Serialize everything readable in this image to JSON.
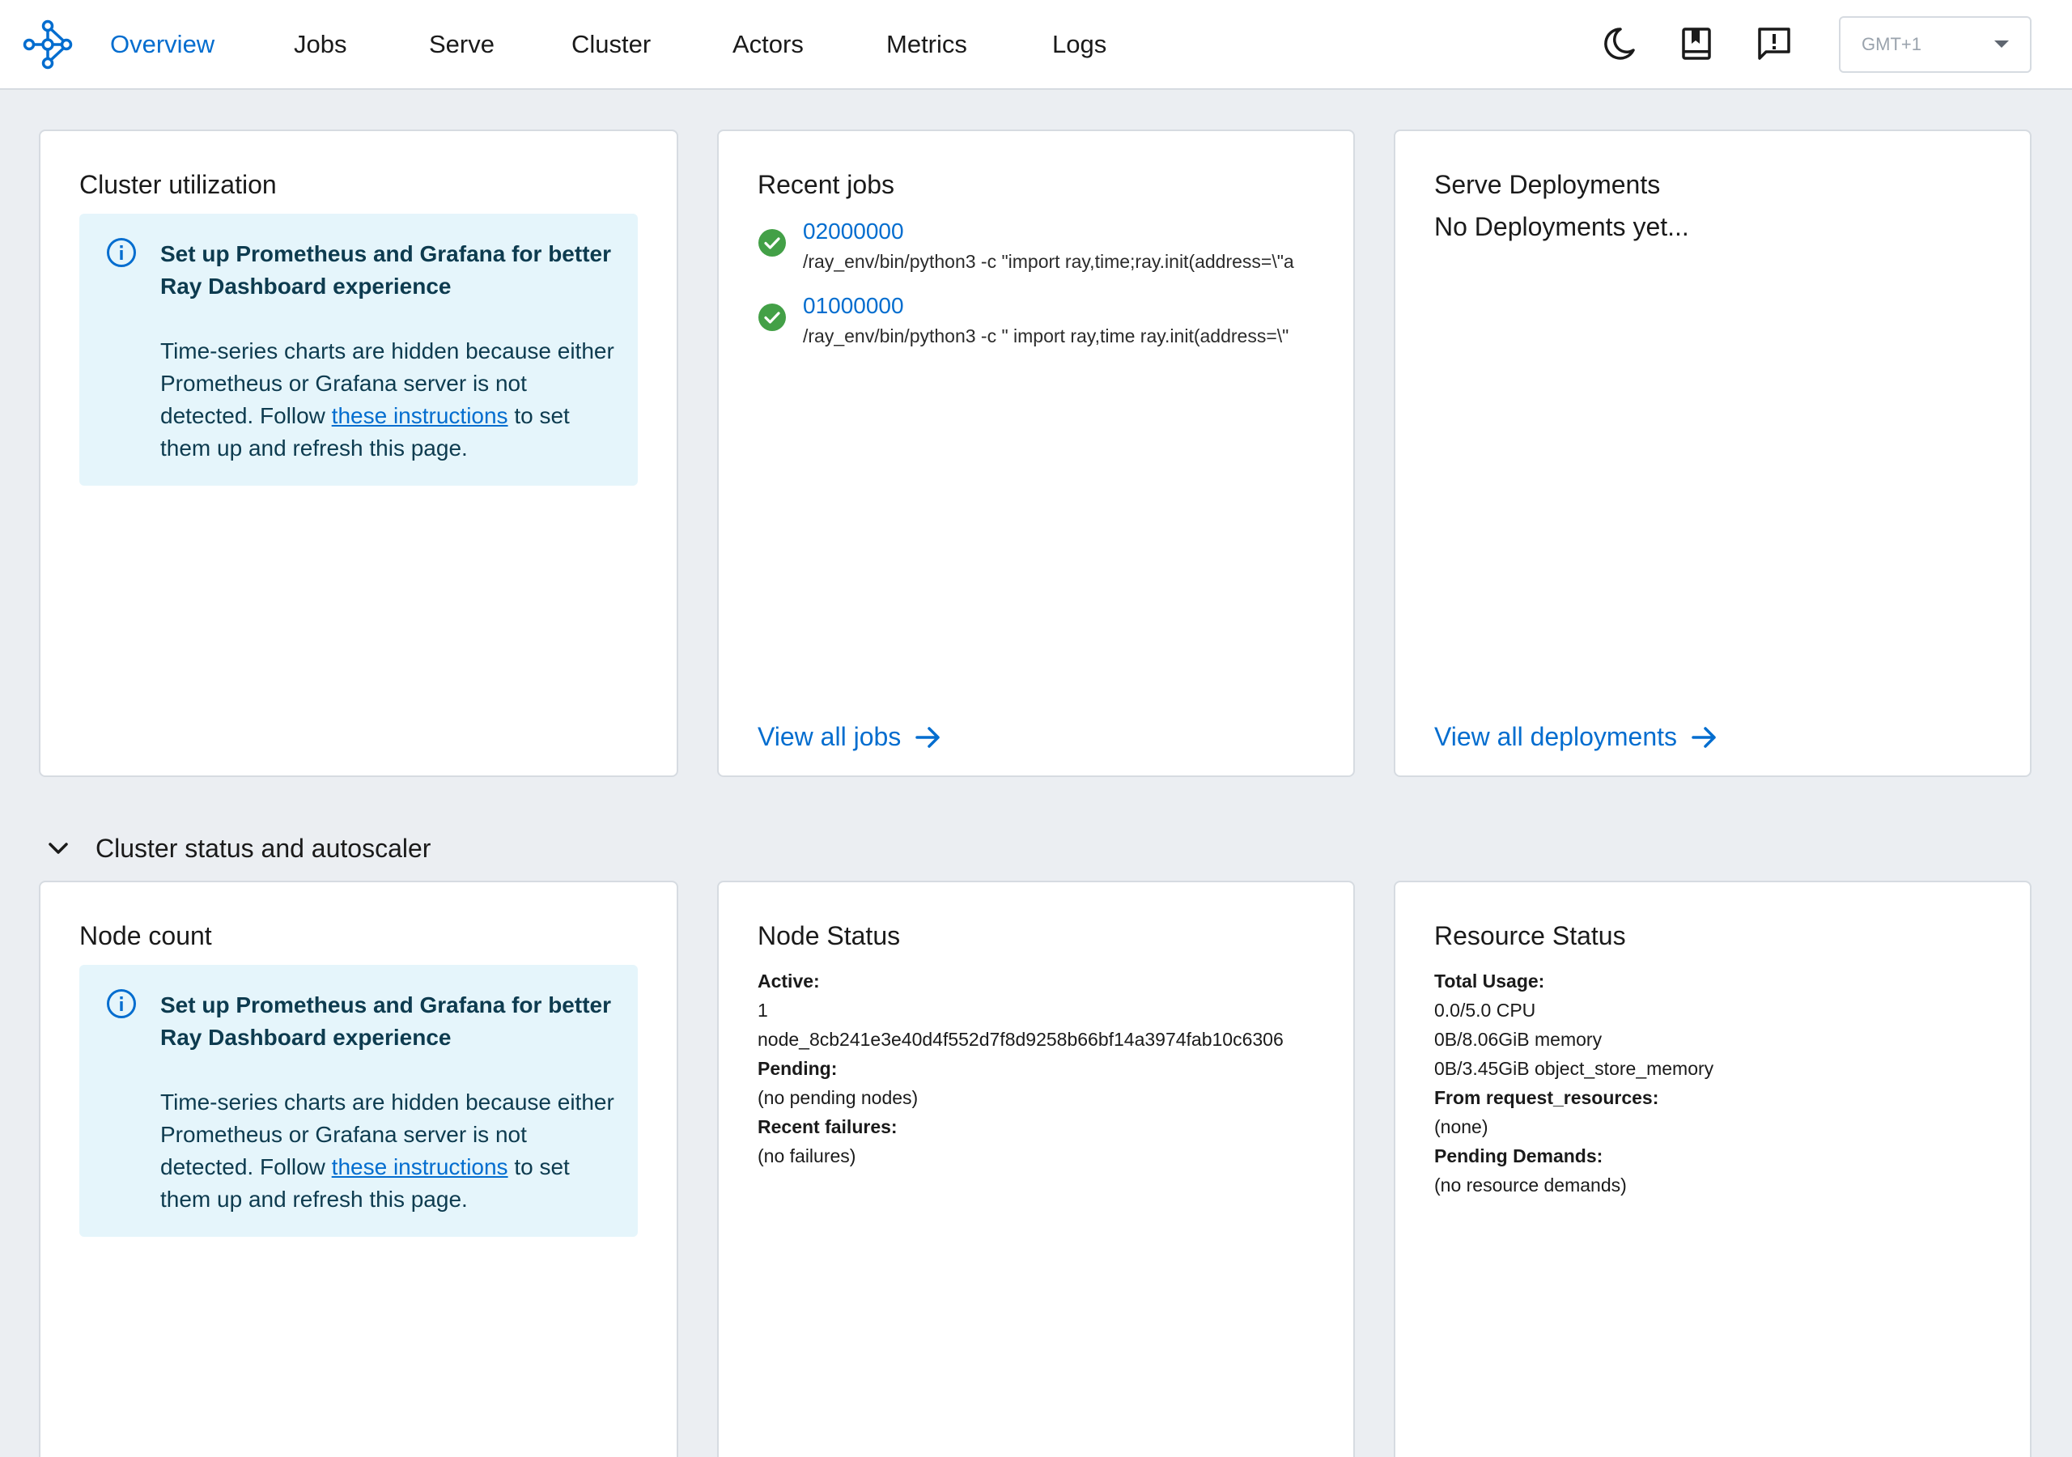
{
  "nav": {
    "items": [
      {
        "label": "Overview",
        "active": true
      },
      {
        "label": "Jobs",
        "active": false
      },
      {
        "label": "Serve",
        "active": false
      },
      {
        "label": "Cluster",
        "active": false
      },
      {
        "label": "Actors",
        "active": false
      },
      {
        "label": "Metrics",
        "active": false
      },
      {
        "label": "Logs",
        "active": false
      }
    ],
    "icons": [
      "theme-toggle-moon-icon",
      "docs-book-icon",
      "feedback-icon"
    ],
    "timezone": "GMT+1"
  },
  "colors": {
    "accent": "#036dcf",
    "success": "#43a047",
    "alert_bg": "#e5f5fb",
    "page_bg": "#ebeef2"
  },
  "prometheus_alert": {
    "title": "Set up Prometheus and Grafana for better Ray Dashboard experience",
    "body_before": "Time-series charts are hidden because either Prometheus or Grafana server is not detected. Follow ",
    "link": "these instructions",
    "body_after": " to set them up and refresh this page."
  },
  "cluster_utilization": {
    "title": "Cluster utilization"
  },
  "recent_jobs": {
    "title": "Recent jobs",
    "jobs": [
      {
        "id": "02000000",
        "command": "/ray_env/bin/python3 -c \"import ray,time;ray.init(address=\\\"a",
        "status": "succeeded"
      },
      {
        "id": "01000000",
        "command": "/ray_env/bin/python3 -c \" import ray,time ray.init(address=\\\"",
        "status": "succeeded"
      }
    ],
    "view_all": "View all jobs"
  },
  "serve_deployments": {
    "title": "Serve Deployments",
    "empty_text": "No Deployments yet...",
    "view_all": "View all deployments"
  },
  "cluster_status_section": {
    "label": "Cluster status and autoscaler"
  },
  "node_count": {
    "title": "Node count"
  },
  "node_status": {
    "title": "Node Status",
    "active_label": "Active:",
    "active_count": "1",
    "active_node": "node_8cb241e3e40d4f552d7f8d9258b66bf14a3974fab10c6306",
    "pending_label": "Pending:",
    "pending_value": "(no pending nodes)",
    "failures_label": "Recent failures:",
    "failures_value": "(no failures)"
  },
  "resource_status": {
    "title": "Resource Status",
    "total_label": "Total Usage:",
    "cpu": "0.0/5.0 CPU",
    "memory": "0B/8.06GiB memory",
    "object_store": "0B/3.45GiB object_store_memory",
    "request_label": "From request_resources:",
    "request_value": "(none)",
    "pending_label": "Pending Demands:",
    "pending_value": "(no resource demands)"
  }
}
